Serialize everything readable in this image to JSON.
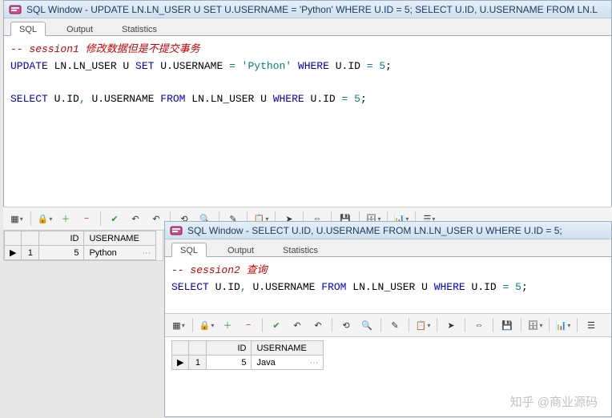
{
  "win1": {
    "title": "SQL Window - UPDATE LN.LN_USER U SET U.USERNAME = 'Python' WHERE U.ID = 5; SELECT U.ID, U.USERNAME FROM LN.L",
    "tabs": {
      "sql": "SQL",
      "output": "Output",
      "stats": "Statistics"
    },
    "code": {
      "c1a": "-- session1 ",
      "c1b": "修改数据但是不提交事务",
      "l2": {
        "update": "UPDATE",
        "tbl": " LN.LN_USER U ",
        "set": "SET",
        "col": " U.USERNAME ",
        "eq": "= ",
        "val": "'Python'",
        "sp": " ",
        "where": "WHERE",
        "cond": " U.ID ",
        "eq2": "= ",
        "num": "5",
        "semi": ";"
      },
      "l3": {
        "select": "SELECT",
        "cols": " U.ID",
        "comma": ", ",
        "col2": "U.USERNAME ",
        "from": "FROM",
        "tbl": " LN.LN_USER U ",
        "where": "WHERE",
        "cond": " U.ID ",
        "eq": "= ",
        "num": "5",
        "semi": ";"
      }
    },
    "grid": {
      "h_id": "ID",
      "h_user": "USERNAME",
      "ptr": "▶",
      "rownum": "1",
      "id": "5",
      "username": "Python",
      "dots": "···"
    }
  },
  "win2": {
    "title": "SQL Window - SELECT U.ID, U.USERNAME FROM LN.LN_USER U WHERE U.ID = 5;",
    "tabs": {
      "sql": "SQL",
      "output": "Output",
      "stats": "Statistics"
    },
    "code": {
      "c1a": "-- session2 ",
      "c1b": "查询",
      "l2": {
        "select": "SELECT",
        "cols": " U.ID",
        "comma": ", ",
        "col2": "U.USERNAME ",
        "from": "FROM",
        "tbl": " LN.LN_USER U ",
        "where": "WHERE",
        "cond": " U.ID ",
        "eq": "= ",
        "num": "5",
        "semi": ";"
      }
    },
    "grid": {
      "h_id": "ID",
      "h_user": "USERNAME",
      "ptr": "▶",
      "rownum": "1",
      "id": "5",
      "username": "Java",
      "dots": "···"
    }
  },
  "icons": {
    "grid": "▦",
    "lock": "🔒",
    "plus": "＋",
    "minus": "−",
    "check": "✔",
    "undo": "↶",
    "refresh": "⟲",
    "binoc": "🔍",
    "pencil": "✎",
    "clip": "📋",
    "arrowr": "➤",
    "link": "⇔",
    "save": "💾",
    "db": "🗄",
    "chart": "📊",
    "list": "☰"
  },
  "watermark": "知乎 @商业源码"
}
